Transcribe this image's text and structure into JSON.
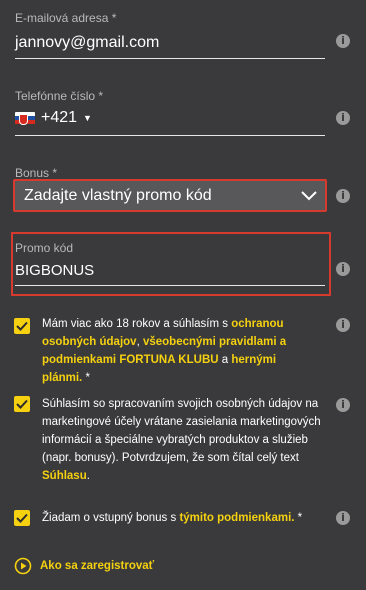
{
  "email": {
    "label": "E-mailová adresa *",
    "value": "jannovy@gmail.com"
  },
  "phone": {
    "label": "Telefónne číslo *",
    "country_code": "+421",
    "flag": "slovakia-flag",
    "dropdown_icon": "caret-down-icon"
  },
  "bonus": {
    "label": "Bonus *",
    "selected": "Zadajte vlastný promo kód",
    "dropdown_icon": "chevron-down-icon"
  },
  "promo": {
    "label": "Promo kód",
    "value": "BIGBONUS"
  },
  "consents": [
    {
      "text1": "Mám viac ako 18 rokov a súhlasím s ",
      "link1": "ochranou osobných údajov",
      "text2": ", ",
      "link2": "všeobecnými pravidlami a podmienkami FORTUNA KLUBU",
      "text3": " a ",
      "link3": "hernými plánmi.",
      "text4": " *"
    },
    {
      "text1": "Súhlasím so spracovaním svojich osobných údajov na marketingové účely vrátane zasielania marketingových informácií a špeciálne vybratých produktov a služieb (napr. bonusy). Potvrdzujem, že som čítal celý text ",
      "link1": "Súhlasu",
      "text2": "."
    },
    {
      "text1": "Žiadam o vstupný bonus s ",
      "link1": "týmito podmienkami.",
      "text2": " *"
    }
  ],
  "how_to": {
    "label": "Ako sa zaregistrovať",
    "icon": "play-circle-icon"
  },
  "colors": {
    "accent": "#f5d10f",
    "highlight_border": "#d63a2f",
    "background": "#3a3a3c"
  },
  "info_icon_glyph": "i"
}
